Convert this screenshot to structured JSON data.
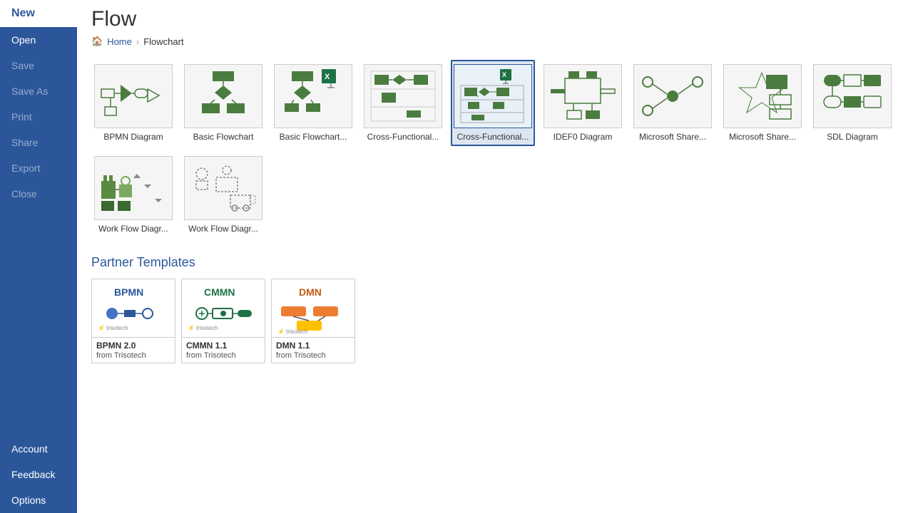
{
  "sidebar": {
    "items": [
      {
        "id": "new",
        "label": "New",
        "active": true,
        "disabled": false
      },
      {
        "id": "open",
        "label": "Open",
        "active": false,
        "disabled": false
      },
      {
        "id": "save",
        "label": "Save",
        "active": false,
        "disabled": true
      },
      {
        "id": "saveas",
        "label": "Save As",
        "active": false,
        "disabled": true
      },
      {
        "id": "print",
        "label": "Print",
        "active": false,
        "disabled": true
      },
      {
        "id": "share",
        "label": "Share",
        "active": false,
        "disabled": true
      },
      {
        "id": "export",
        "label": "Export",
        "active": false,
        "disabled": true
      },
      {
        "id": "close",
        "label": "Close",
        "active": false,
        "disabled": true
      },
      {
        "id": "account",
        "label": "Account",
        "active": false,
        "disabled": false
      },
      {
        "id": "feedback",
        "label": "Feedback",
        "active": false,
        "disabled": false
      },
      {
        "id": "options",
        "label": "Options",
        "active": false,
        "disabled": false
      }
    ]
  },
  "breadcrumb": {
    "home": "Home",
    "separator": "›",
    "current": "Flowchart"
  },
  "page_heading": "Flow",
  "section": {
    "templates_label": "Partner Templates"
  },
  "templates": [
    {
      "id": "bpmn",
      "label": "BPMN Diagram",
      "selected": false
    },
    {
      "id": "basic-flow",
      "label": "Basic Flowchart",
      "selected": false
    },
    {
      "id": "basic-flow-excel",
      "label": "Basic Flowchart...",
      "selected": false
    },
    {
      "id": "cross-func1",
      "label": "Cross-Functional...",
      "selected": false
    },
    {
      "id": "cross-func2",
      "label": "Cross-Functional...",
      "selected": true
    },
    {
      "id": "idef0",
      "label": "IDEF0 Diagram",
      "selected": false
    },
    {
      "id": "ms-share1",
      "label": "Microsoft Share...",
      "selected": false
    },
    {
      "id": "ms-share2",
      "label": "Microsoft Share...",
      "selected": false
    },
    {
      "id": "sdl",
      "label": "SDL Diagram",
      "selected": false
    },
    {
      "id": "workflow1",
      "label": "Work Flow Diagr...",
      "selected": false
    },
    {
      "id": "workflow2",
      "label": "Work Flow Diagr...",
      "selected": false
    }
  ],
  "partner_templates": [
    {
      "id": "bpmn2",
      "label": "BPMN 2.0",
      "sublabel": "from Trisotech",
      "badge": "BPMN"
    },
    {
      "id": "cmmn",
      "label": "CMMN 1.1",
      "sublabel": "from Trisotech",
      "badge": "CMMN"
    },
    {
      "id": "dmn",
      "label": "DMN 1.1",
      "sublabel": "from Trisotech",
      "badge": "DMN"
    }
  ]
}
